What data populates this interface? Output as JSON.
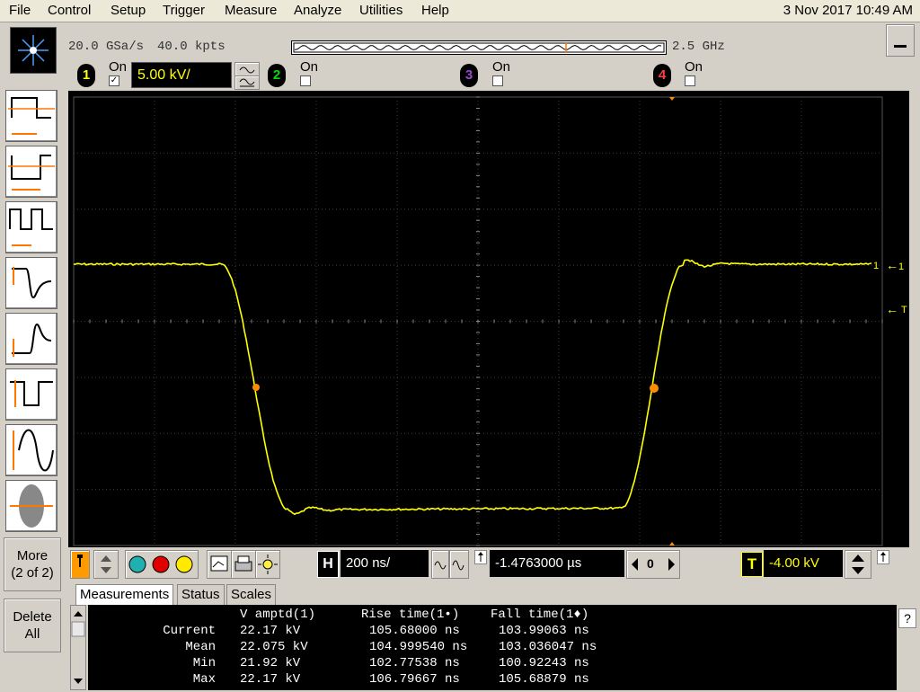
{
  "menu": {
    "items": [
      "File",
      "Control",
      "Setup",
      "Trigger",
      "Measure",
      "Analyze",
      "Utilities",
      "Help"
    ],
    "datetime": "3 Nov 2017 10:49 AM"
  },
  "acq": {
    "sample_rate": "20.0 GSa/s",
    "points": "40.0 kpts",
    "bandwidth": "2.5 GHz"
  },
  "channels": [
    {
      "num": "1",
      "label": "On",
      "checked": true,
      "scale": "5.00 kV/",
      "color": "#ffff00"
    },
    {
      "num": "2",
      "label": "On",
      "checked": false,
      "color": "#00cc00"
    },
    {
      "num": "3",
      "label": "On",
      "checked": false,
      "color": "#7a2a9a"
    },
    {
      "num": "4",
      "label": "On",
      "checked": false,
      "color": "#e03030"
    }
  ],
  "left_panel": {
    "more_label": "More",
    "more_sub": "(2 of 2)",
    "delete_label": "Delete",
    "delete_sub": "All"
  },
  "screen": {
    "ch1_marker": "1",
    "trigger_marker": "T"
  },
  "horizontal": {
    "label": "H",
    "scale": "200 ns/",
    "position": "-1.4763000 µs",
    "ref": "0"
  },
  "trigger": {
    "label": "T",
    "level": "-4.00 kV"
  },
  "tabs": [
    "Measurements",
    "Status",
    "Scales"
  ],
  "measurements": {
    "headers": [
      "V amptd(1)",
      "Rise time(1•)",
      "Fall time(1♦)"
    ],
    "rows": [
      {
        "label": "Current",
        "v": "22.17 kV",
        "rise": "105.68000 ns",
        "fall": "103.99063 ns"
      },
      {
        "label": "Mean",
        "v": "22.075 kV",
        "rise": "104.999540 ns",
        "fall": "103.036047 ns"
      },
      {
        "label": "Min",
        "v": "21.92 kV",
        "rise": "102.77538 ns",
        "fall": "100.92243 ns"
      },
      {
        "label": "Max",
        "v": "22.17 kV",
        "rise": "106.79667 ns",
        "fall": "105.68879 ns"
      }
    ],
    "help": "?"
  }
}
